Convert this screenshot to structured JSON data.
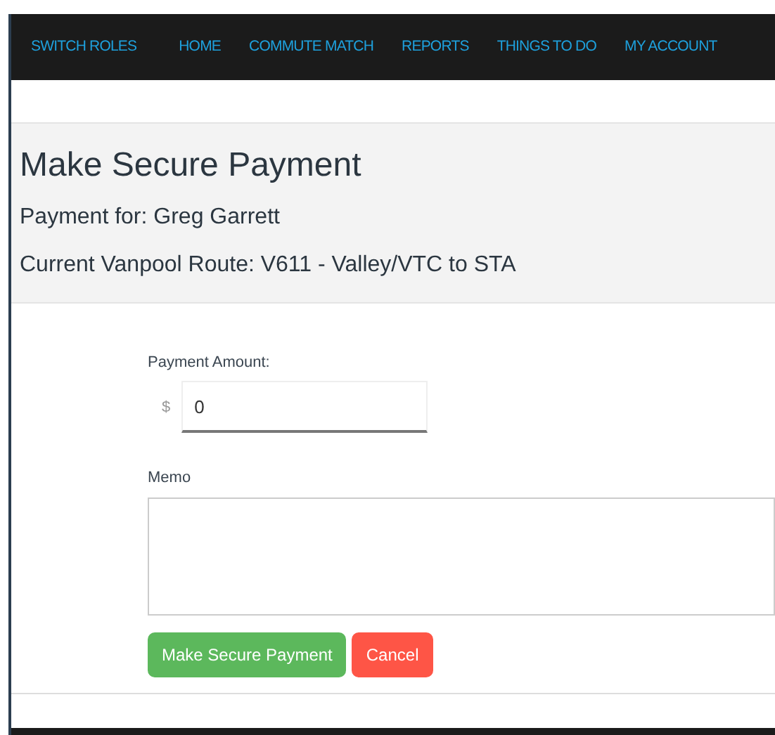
{
  "nav": [
    {
      "label": "SWITCH ROLES"
    },
    {
      "label": "HOME"
    },
    {
      "label": "COMMUTE MATCH"
    },
    {
      "label": "REPORTS"
    },
    {
      "label": "THINGS TO DO"
    },
    {
      "label": "MY ACCOUNT"
    }
  ],
  "header": {
    "title": "Make Secure Payment",
    "payment_for": "Payment for: Greg Garrett",
    "route": "Current Vanpool Route: V611 - Valley/VTC to STA"
  },
  "form": {
    "amount_label": "Payment Amount:",
    "currency": "$",
    "amount_value": "0",
    "memo_label": "Memo"
  },
  "buttons": [
    {
      "label": "Make Secure Payment",
      "kind": "primary"
    },
    {
      "label": "Cancel",
      "kind": "cancel"
    }
  ]
}
